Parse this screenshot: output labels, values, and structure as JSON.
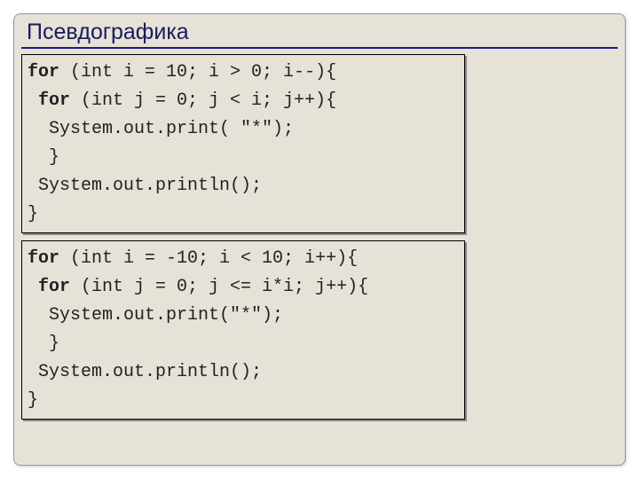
{
  "title": "Псевдографика",
  "block1": {
    "l1a": "for",
    "l1b": " (int i = 10; i > 0; i--){",
    "l2a": " for",
    "l2b": " (int j = 0; j < i; j++){",
    "l3": "  System.out.print( \"*\");",
    "l4": "  }",
    "l5": " System.out.println();",
    "l6": "}"
  },
  "block2": {
    "l1a": "for",
    "l1b": " (int i = -10; i < 10; i++){",
    "l2a": " for",
    "l2b": " (int j = 0; j <= i*i; j++){",
    "l3": "  System.out.print(\"*\");",
    "l4": "  }",
    "l5": " System.out.println();",
    "l6": "}"
  }
}
